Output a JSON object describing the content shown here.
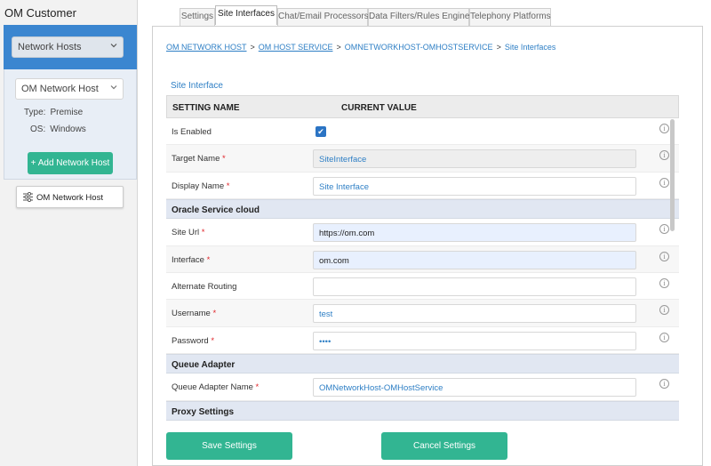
{
  "app": {
    "title": "OM Customer"
  },
  "sidebar": {
    "network_select": "Network Hosts",
    "host_select": "OM Network Host",
    "type_label": "Type:",
    "type_value": "Premise",
    "os_label": "OS:",
    "os_value": "Windows",
    "add_button": "+ Add Network Host",
    "host_card": "OM Network Host"
  },
  "tabs": [
    {
      "label": "Settings"
    },
    {
      "label": "Site Interfaces"
    },
    {
      "label": "Chat/Email Processors"
    },
    {
      "label": "Data Filters/Rules Engine"
    },
    {
      "label": "Telephony Platforms"
    }
  ],
  "breadcrumb": {
    "items": [
      "OM NETWORK HOST",
      "OM HOST SERVICE",
      "OMNETWORKHOST-OMHOSTSERVICE",
      "Site Interfaces"
    ],
    "separator": ">"
  },
  "section_title": "Site Interface",
  "grid": {
    "col_setting": "SETTING NAME",
    "col_value": "CURRENT VALUE",
    "info_glyph": "i",
    "required_mark": "*",
    "checkbox_glyph": "✔",
    "rows": {
      "is_enabled": {
        "label": "Is Enabled",
        "checked": true
      },
      "target_name": {
        "label": "Target Name",
        "value": "SiteInterface"
      },
      "display_name": {
        "label": "Display Name",
        "value": "Site Interface"
      },
      "group_oracle": "Oracle Service cloud",
      "site_url": {
        "label": "Site Url",
        "value": "https://om.com"
      },
      "interface": {
        "label": "Interface",
        "value": "om.com"
      },
      "alternate_routing": {
        "label": "Alternate Routing",
        "value": ""
      },
      "username": {
        "label": "Username",
        "value": "test"
      },
      "password": {
        "label": "Password",
        "value": "••••"
      },
      "group_queue": "Queue Adapter",
      "queue_adapter_name": {
        "label": "Queue Adapter Name",
        "value": "OMNetworkHost-OMHostService"
      },
      "group_proxy": "Proxy Settings"
    }
  },
  "buttons": {
    "save": "Save Settings",
    "cancel": "Cancel Settings"
  },
  "colors": {
    "accent_blue": "#3b86d0",
    "button_green": "#32b592",
    "link_blue": "#2e7fc5",
    "required_red": "#e0262b"
  }
}
